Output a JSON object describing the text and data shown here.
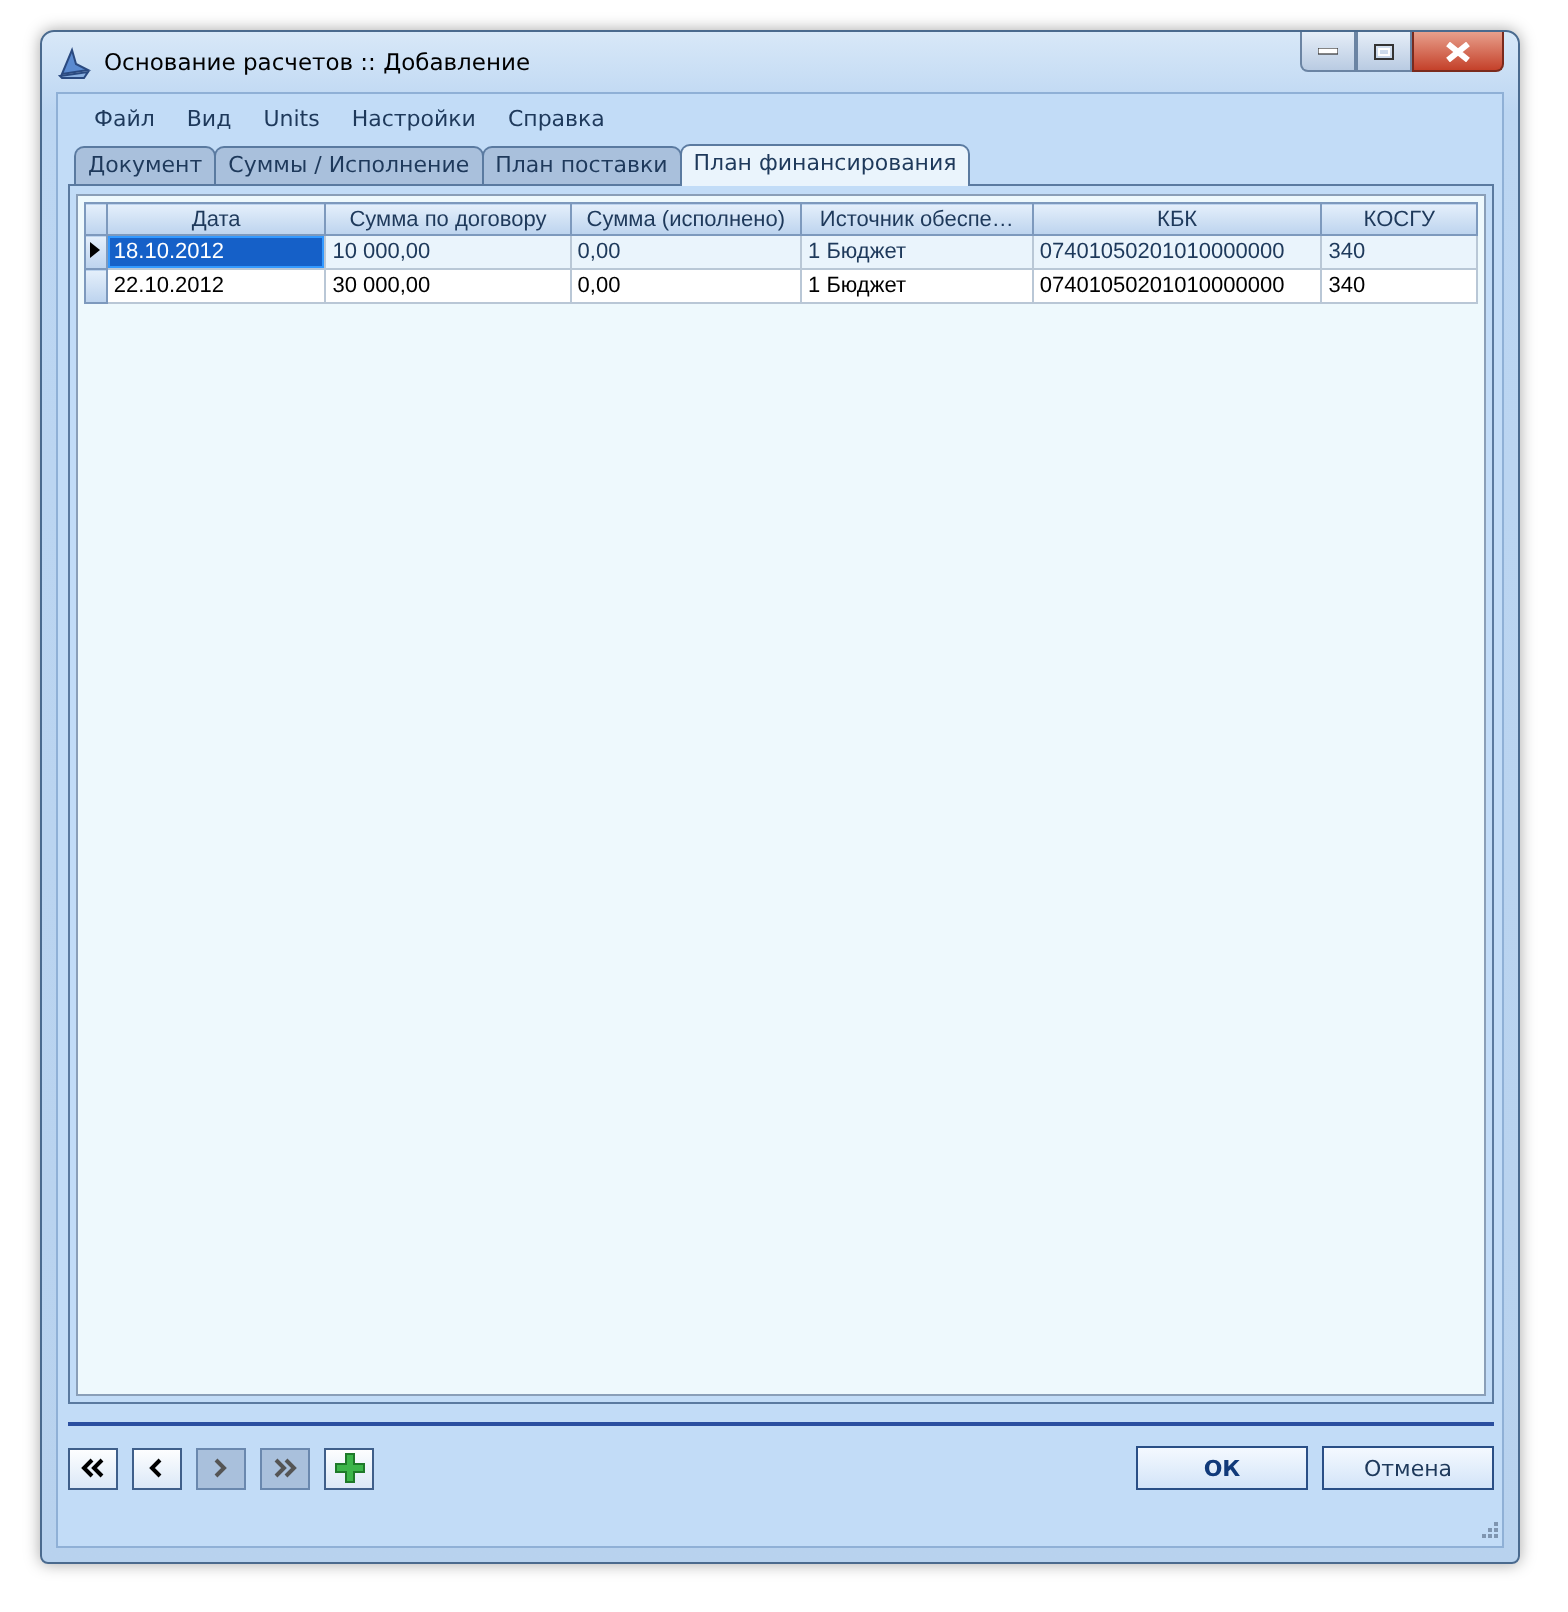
{
  "window": {
    "title": "Основание расчетов :: Добавление"
  },
  "menu": [
    "Файл",
    "Вид",
    "Units",
    "Настройки",
    "Справка"
  ],
  "tabs": [
    {
      "label": "Документ",
      "selected": false
    },
    {
      "label": "Суммы / Исполнение",
      "selected": false
    },
    {
      "label": "План поставки",
      "selected": false
    },
    {
      "label": "План финансирования",
      "selected": true
    }
  ],
  "table": {
    "columns": [
      "Дата",
      "Сумма по договору",
      "Сумма (исполнено)",
      "Источник обеспе…",
      "КБК",
      "КОСГУ"
    ],
    "rows": [
      {
        "selected": true,
        "cells": [
          "18.10.2012",
          "10 000,00",
          "0,00",
          "1 Бюджет",
          "07401050201010000000",
          "340"
        ]
      },
      {
        "selected": false,
        "cells": [
          "22.10.2012",
          "30 000,00",
          "0,00",
          "1 Бюджет",
          "07401050201010000000",
          "340"
        ]
      }
    ]
  },
  "navigation": [
    {
      "kind": "first",
      "disabled": false
    },
    {
      "kind": "prev",
      "disabled": false
    },
    {
      "kind": "next",
      "disabled": true
    },
    {
      "kind": "last",
      "disabled": true
    },
    {
      "kind": "add",
      "disabled": false
    }
  ],
  "buttons": [
    {
      "label": "ОК",
      "default": true
    },
    {
      "label": "Отмена",
      "default": false
    }
  ]
}
